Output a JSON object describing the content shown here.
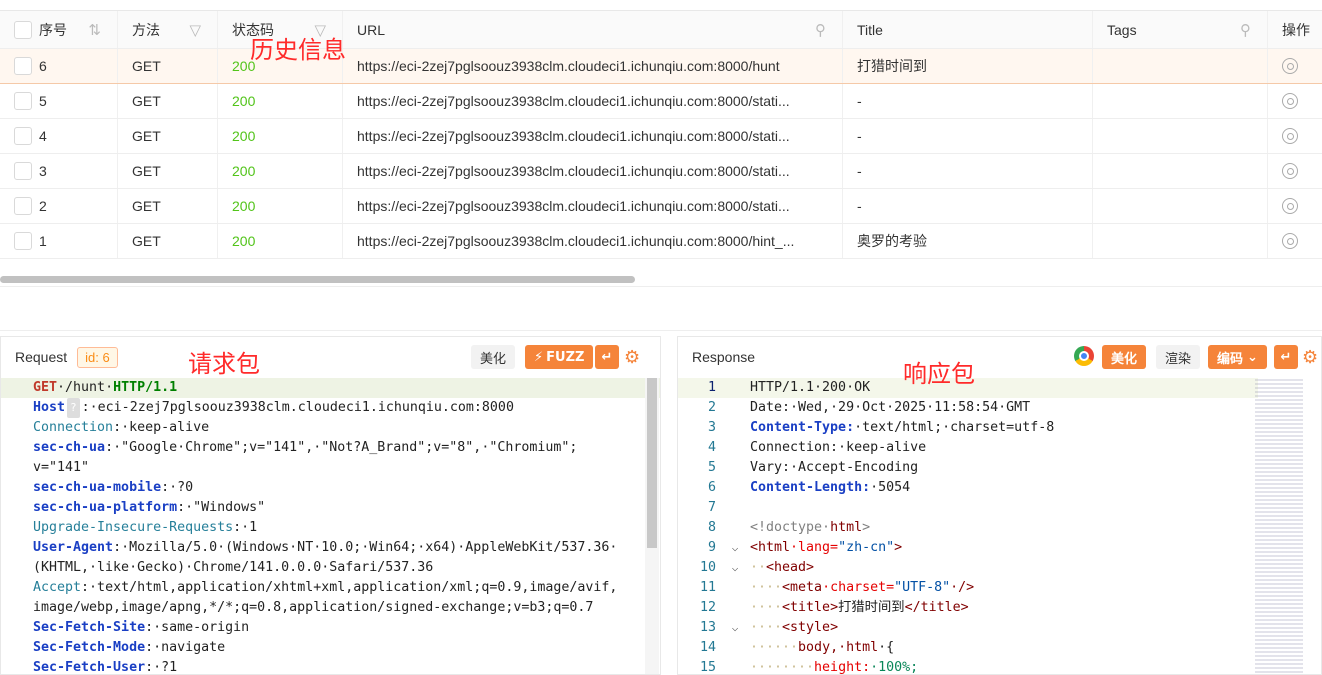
{
  "table": {
    "headers": {
      "no": "序号",
      "method": "方法",
      "status": "状态码",
      "url": "URL",
      "title": "Title",
      "tags": "Tags",
      "ops": "操作"
    },
    "rows": [
      {
        "no": "6",
        "method": "GET",
        "status": "200",
        "url": "https://eci-2zej7pglsoouz3938clm.cloudeci1.ichunqiu.com:8000/hunt",
        "title": "打猎时间到",
        "tags": ""
      },
      {
        "no": "5",
        "method": "GET",
        "status": "200",
        "url": "https://eci-2zej7pglsoouz3938clm.cloudeci1.ichunqiu.com:8000/stati...",
        "title": "-",
        "tags": ""
      },
      {
        "no": "4",
        "method": "GET",
        "status": "200",
        "url": "https://eci-2zej7pglsoouz3938clm.cloudeci1.ichunqiu.com:8000/stati...",
        "title": "-",
        "tags": ""
      },
      {
        "no": "3",
        "method": "GET",
        "status": "200",
        "url": "https://eci-2zej7pglsoouz3938clm.cloudeci1.ichunqiu.com:8000/stati...",
        "title": "-",
        "tags": ""
      },
      {
        "no": "2",
        "method": "GET",
        "status": "200",
        "url": "https://eci-2zej7pglsoouz3938clm.cloudeci1.ichunqiu.com:8000/stati...",
        "title": "-",
        "tags": ""
      },
      {
        "no": "1",
        "method": "GET",
        "status": "200",
        "url": "https://eci-2zej7pglsoouz3938clm.cloudeci1.ichunqiu.com:8000/hint_...",
        "title": "奥罗的考验",
        "tags": ""
      }
    ]
  },
  "annotations": {
    "history": "历史信息",
    "request": "请求包",
    "response": "响应包"
  },
  "request": {
    "title": "Request",
    "id_label": "id: 6",
    "beautify": "美化",
    "fuzz": "FUZZ",
    "wrap": "↵",
    "host_badge": "?",
    "lines": {
      "l1_method": "GET",
      "l1_path": "·/hunt·",
      "l1_proto": "HTTP/1.1",
      "host_k": "Host",
      "host_v": ":·eci-2zej7pglsoouz3938clm.cloudeci1.ichunqiu.com:8000",
      "conn_k": "Connection",
      "conn_v": ":·keep-alive",
      "ua_k": "sec-ch-ua",
      "ua_v": ":·\"Google·Chrome\";v=\"141\",·\"Not?A_Brand\";v=\"8\",·\"Chromium\";",
      "ua_v2": "v=\"141\"",
      "mob_k": "sec-ch-ua-mobile",
      "mob_v": ":·?0",
      "plat_k": "sec-ch-ua-platform",
      "plat_v": ":·\"Windows\"",
      "uir_k": "Upgrade-Insecure-Requests",
      "uir_v": ":·1",
      "agent_k": "User-Agent",
      "agent_v": ":·Mozilla/5.0·(Windows·NT·10.0;·Win64;·x64)·AppleWebKit/537.36·",
      "agent_v2": "(KHTML,·like·Gecko)·Chrome/141.0.0.0·Safari/537.36",
      "acc_k": "Accept",
      "acc_v": ":·text/html,application/xhtml+xml,application/xml;q=0.9,image/avif,",
      "acc_v2": "image/webp,image/apng,*/*;q=0.8,application/signed-exchange;v=b3;q=0.7",
      "sfs_k": "Sec-Fetch-Site",
      "sfs_v": ":·same-origin",
      "sfm_k": "Sec-Fetch-Mode",
      "sfm_v": ":·navigate",
      "sfu_k": "Sec-Fetch-User",
      "sfu_v": ":·?1"
    }
  },
  "response": {
    "title": "Response",
    "beautify": "美化",
    "render": "渲染",
    "encode": "编码",
    "wrap": "↵",
    "lines": {
      "n1": "1",
      "l1": "HTTP/1.1·200·OK",
      "n2": "2",
      "l2": "Date:·Wed,·29·Oct·2025·11:58:54·GMT",
      "n3": "3",
      "l3k": "Content-Type:",
      "l3v": "·text/html;·charset=utf-8",
      "n4": "4",
      "l4": "Connection:·keep-alive",
      "n5": "5",
      "l5": "Vary:·Accept-Encoding",
      "n6": "6",
      "l6k": "Content-Length:",
      "l6v": "·5054",
      "n7": "7",
      "n8": "8",
      "l8a": "<!doctype·",
      "l8b": "html",
      "l8c": ">",
      "n9": "9",
      "l9a": "<html",
      "l9b": "·lang=",
      "l9c": "\"zh-cn\"",
      "l9d": ">",
      "n10": "10",
      "l10a": "··",
      "l10b": "<head>",
      "n11": "11",
      "l11a": "····",
      "l11b": "<meta",
      "l11c": "·charset=",
      "l11d": "\"UTF-8\"",
      "l11e": "·/>",
      "n12": "12",
      "l12a": "····",
      "l12b": "<title>",
      "l12c": "打猎时间到",
      "l12d": "</title>",
      "n13": "13",
      "l13a": "····",
      "l13b": "<style>",
      "n14": "14",
      "l14a": "······",
      "l14b": "body,·html",
      "l14c": "·{",
      "n15": "15",
      "l15a": "········",
      "l15b": "height:",
      "l15c": "·100%;"
    }
  }
}
